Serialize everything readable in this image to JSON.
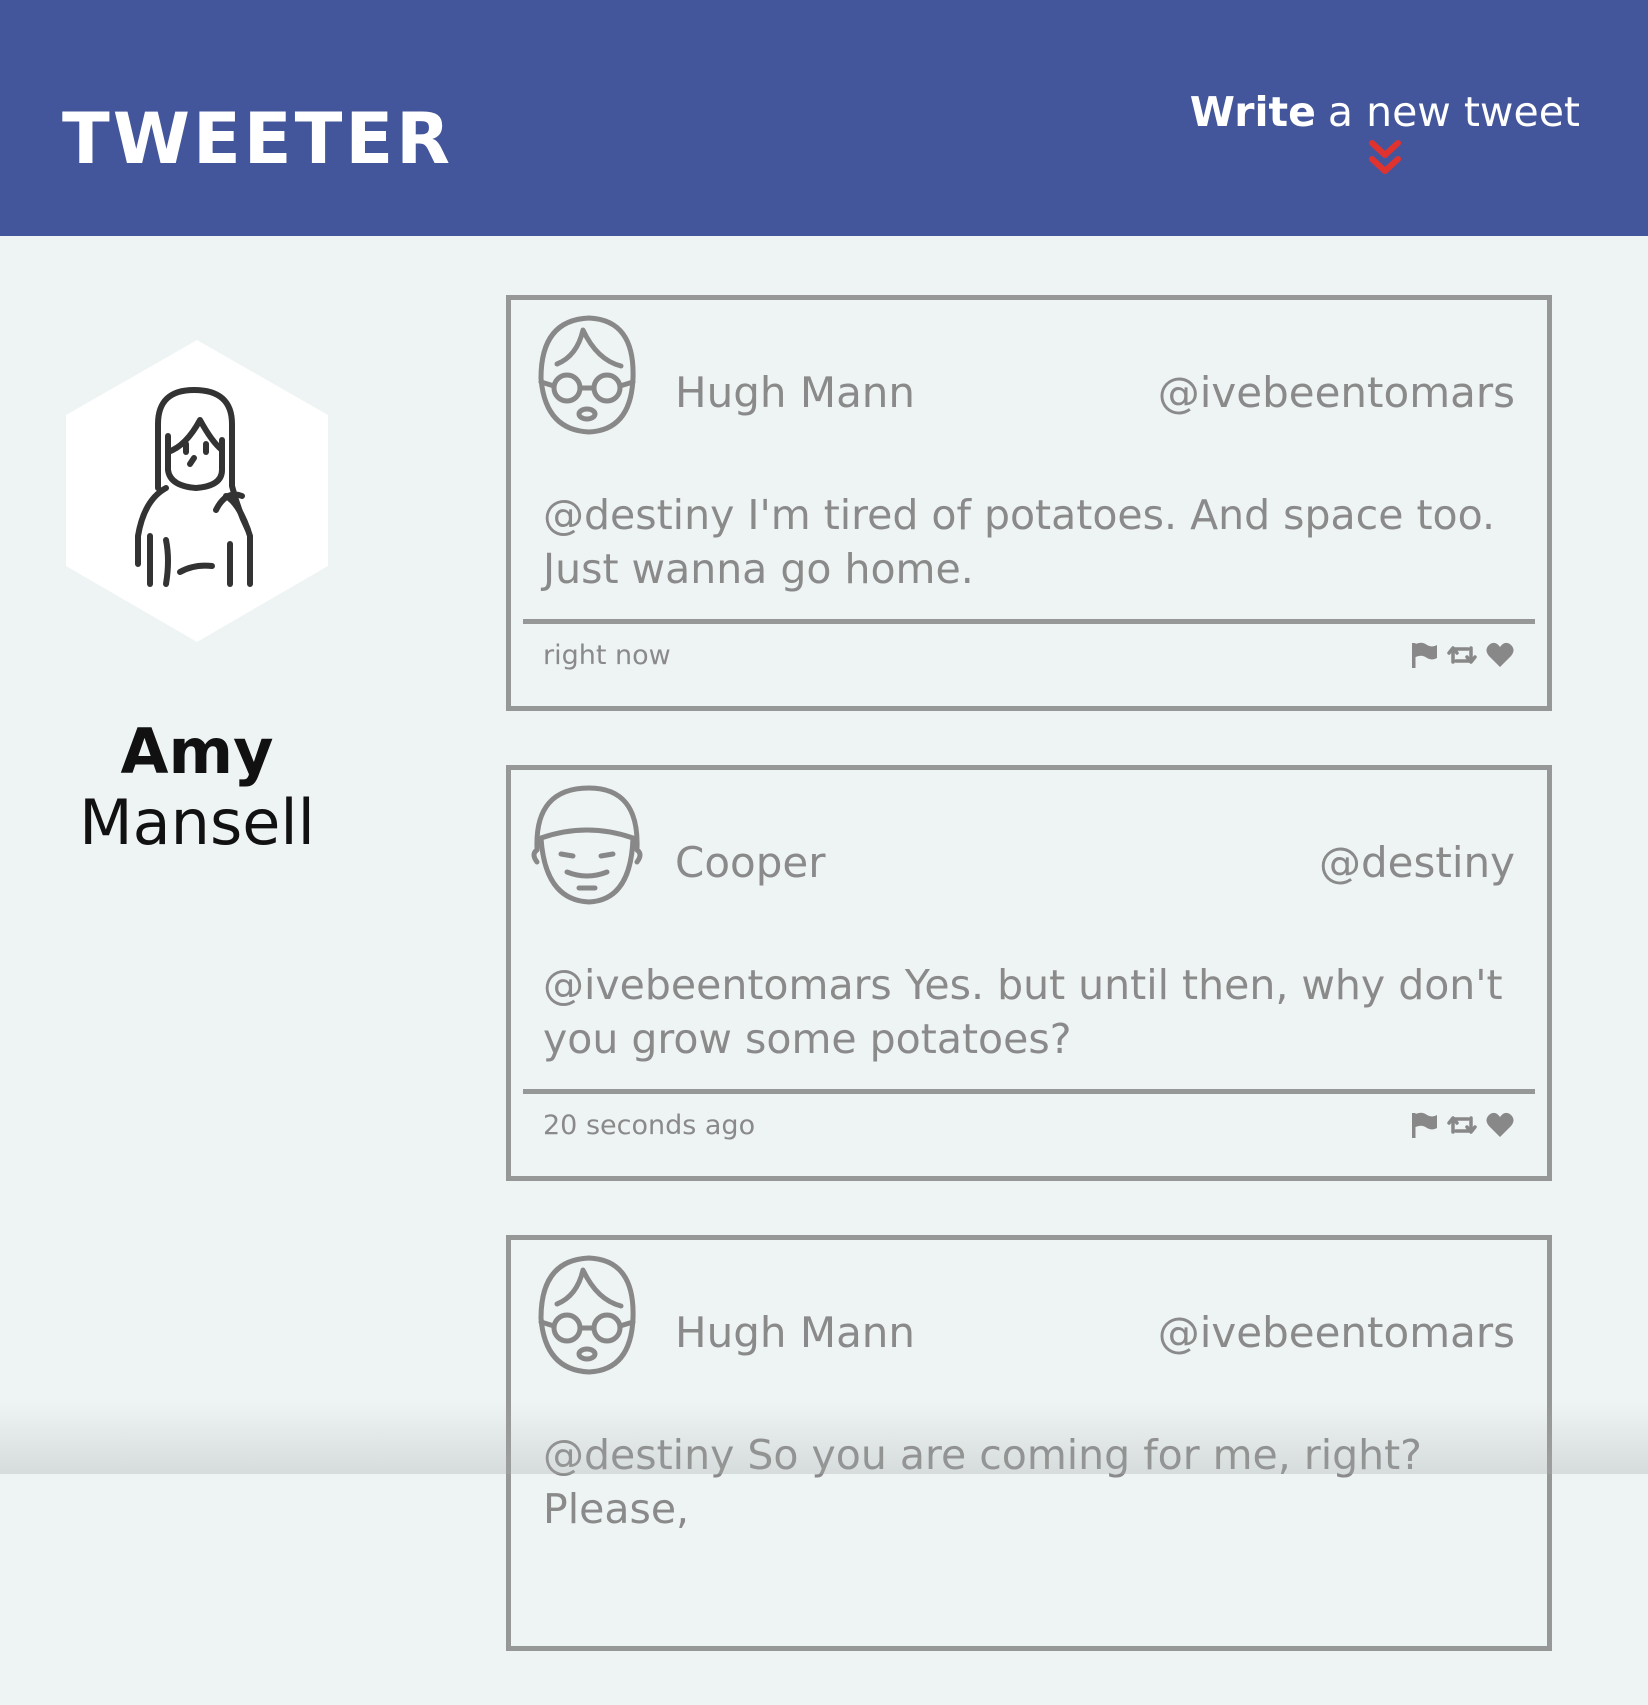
{
  "header": {
    "brand": "TWEETER",
    "compose_strong": "Write",
    "compose_rest": "a new tweet",
    "compose_icon": "chevron-double-down-icon",
    "colors": {
      "bar": "#44569b",
      "chevron": "#e0332f"
    }
  },
  "profile": {
    "avatar_icon": "woman-avatar-icon",
    "first_name": "Amy",
    "last_name": "Mansell"
  },
  "tweets": [
    {
      "avatar_icon": "man-with-glasses-avatar-icon",
      "name": "Hugh Mann",
      "handle": "@ivebeentomars",
      "text": "@destiny I'm tired of potatoes. And space too. Just wanna go home.",
      "time": "right now",
      "actions": [
        "flag-icon",
        "retweet-icon",
        "heart-icon"
      ]
    },
    {
      "avatar_icon": "smiling-man-avatar-icon",
      "name": "Cooper",
      "handle": "@destiny",
      "text": "@ivebeentomars Yes. but until then, why don't you grow some potatoes?",
      "time": "20 seconds ago",
      "actions": [
        "flag-icon",
        "retweet-icon",
        "heart-icon"
      ]
    },
    {
      "avatar_icon": "man-with-glasses-avatar-icon",
      "name": "Hugh Mann",
      "handle": "@ivebeentomars",
      "text": "@destiny So you are coming for me, right? Please,",
      "time": "",
      "actions": []
    }
  ]
}
